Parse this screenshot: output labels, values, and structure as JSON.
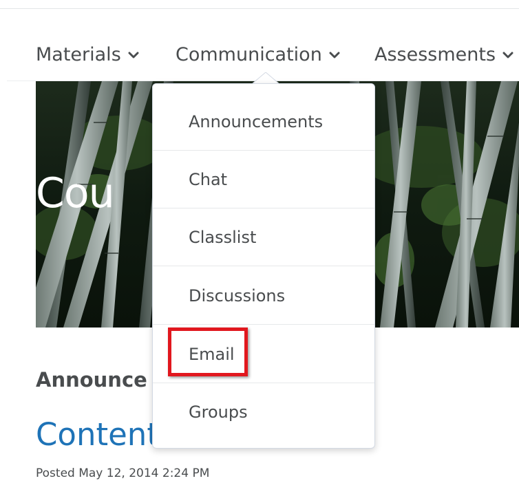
{
  "navbar": {
    "items": [
      {
        "label": "Materials"
      },
      {
        "label": "Communication"
      },
      {
        "label": "Assessments"
      }
    ]
  },
  "banner": {
    "title": "Cou"
  },
  "announcements": {
    "heading": "Announce",
    "item_title": "Content",
    "posted": "Posted May 12, 2014 2:24 PM"
  },
  "dropdown": {
    "items": [
      {
        "label": "Announcements"
      },
      {
        "label": "Chat"
      },
      {
        "label": "Classlist"
      },
      {
        "label": "Discussions"
      },
      {
        "label": "Email"
      },
      {
        "label": "Groups"
      }
    ],
    "highlighted": "Email"
  },
  "colors": {
    "link": "#1e73b7",
    "text": "#494c4e",
    "highlight": "#e1171e"
  },
  "icons": {
    "nav_chevron": "chevron-down-icon"
  }
}
